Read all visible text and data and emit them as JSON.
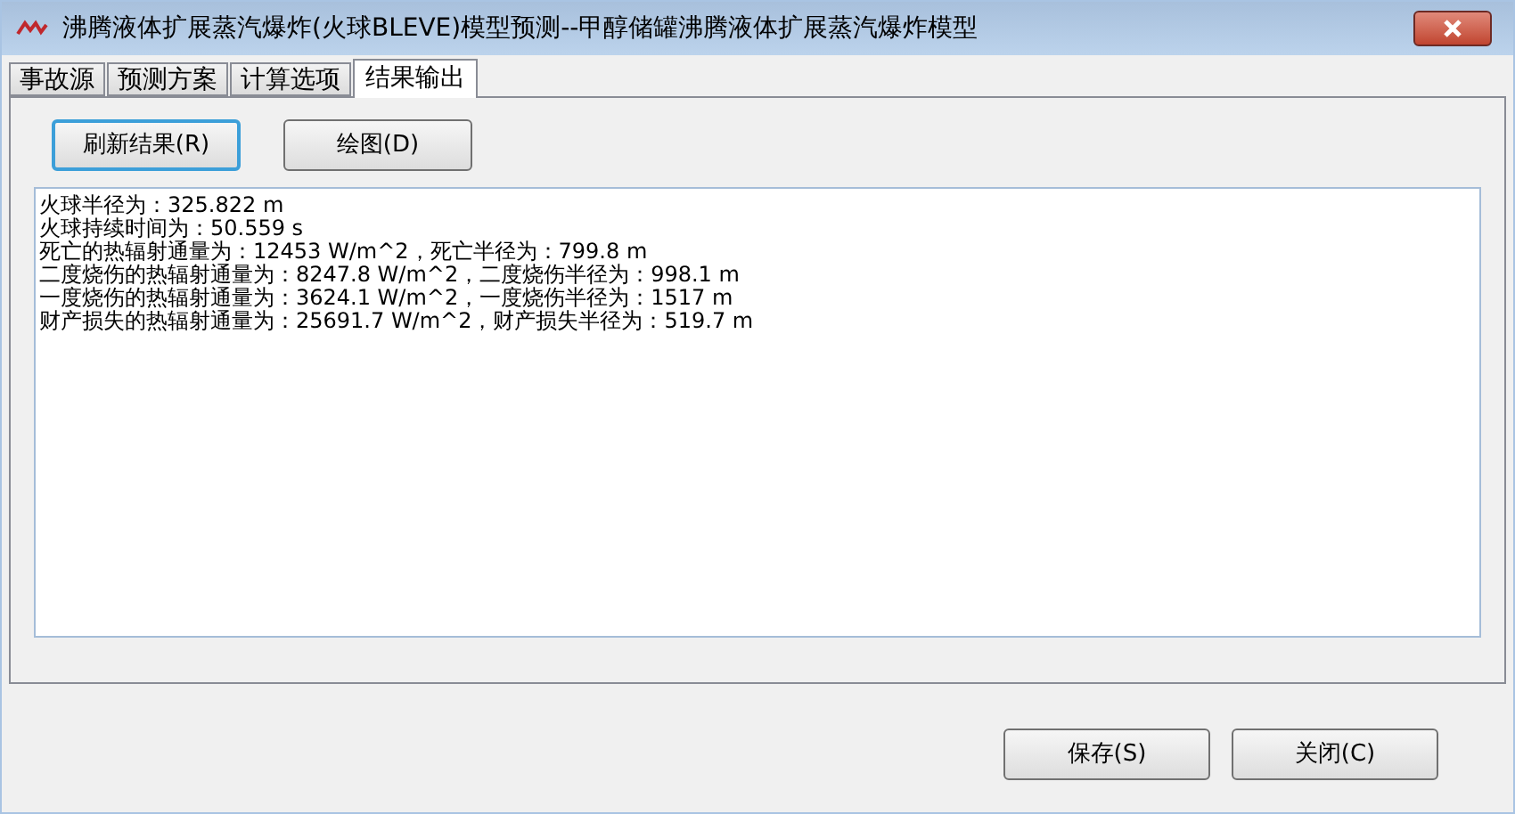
{
  "window": {
    "title": "沸腾液体扩展蒸汽爆炸(火球BLEVE)模型预测--甲醇储罐沸腾液体扩展蒸汽爆炸模型"
  },
  "tabs": [
    {
      "label": "事故源",
      "selected": false
    },
    {
      "label": "预测方案",
      "selected": false
    },
    {
      "label": "计算选项",
      "selected": false
    },
    {
      "label": "结果输出",
      "selected": true
    }
  ],
  "toolbar_buttons": [
    {
      "label": "刷新结果(R)",
      "focused": true
    },
    {
      "label": "绘图(D)",
      "focused": false
    }
  ],
  "results": [
    "火球半径为：325.822 m",
    "火球持续时间为：50.559 s",
    "死亡的热辐射通量为：12453 W/m^2，死亡半径为：799.8 m",
    "二度烧伤的热辐射通量为：8247.8 W/m^2，二度烧伤半径为：998.1 m",
    "一度烧伤的热辐射通量为：3624.1 W/m^2，一度烧伤半径为：1517 m",
    "财产损失的热辐射通量为：25691.7 W/m^2，财产损失半径为：519.7 m"
  ],
  "footer_buttons": [
    "保存(S)",
    "关闭(C)"
  ]
}
